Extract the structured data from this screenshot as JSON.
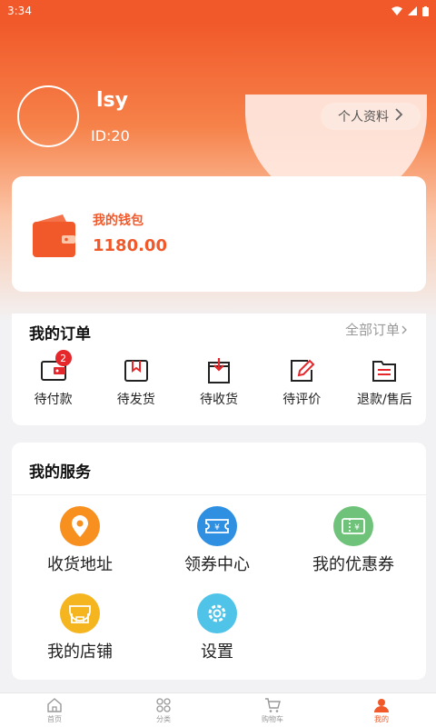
{
  "status_bar": {
    "time": "3:34"
  },
  "profile": {
    "username": "lsy",
    "user_id": "ID:20",
    "profile_button": "个人资料"
  },
  "wallet": {
    "label": "我的钱包",
    "balance": "1180.00"
  },
  "orders": {
    "title": "我的订单",
    "view_all": "全部订单",
    "items": [
      {
        "label": "待付款",
        "badge": "2",
        "icon": "wallet-card-icon"
      },
      {
        "label": "待发货",
        "icon": "package-icon"
      },
      {
        "label": "待收货",
        "icon": "receive-box-icon"
      },
      {
        "label": "待评价",
        "icon": "edit-review-icon"
      },
      {
        "label": "退款/售后",
        "icon": "refund-list-icon"
      }
    ]
  },
  "services": {
    "title": "我的服务",
    "items": [
      {
        "label": "收货地址",
        "icon": "location-pin-icon",
        "color": "#f7901e"
      },
      {
        "label": "领券中心",
        "icon": "coupon-center-icon",
        "color": "#2f8fe0"
      },
      {
        "label": "我的优惠券",
        "icon": "coupon-ticket-icon",
        "color": "#6fc27a"
      },
      {
        "label": "我的店铺",
        "icon": "shop-icon",
        "color": "#f5b51f"
      },
      {
        "label": "设置",
        "icon": "gear-icon",
        "color": "#4fc3e8"
      }
    ]
  },
  "tabbar": {
    "items": [
      {
        "label": "首页",
        "icon": "home-icon"
      },
      {
        "label": "分类",
        "icon": "category-icon"
      },
      {
        "label": "购物车",
        "icon": "cart-icon"
      },
      {
        "label": "我的",
        "icon": "user-icon"
      }
    ],
    "active_index": 3
  },
  "colors": {
    "accent": "#f1592a",
    "badge": "#e5262a"
  }
}
